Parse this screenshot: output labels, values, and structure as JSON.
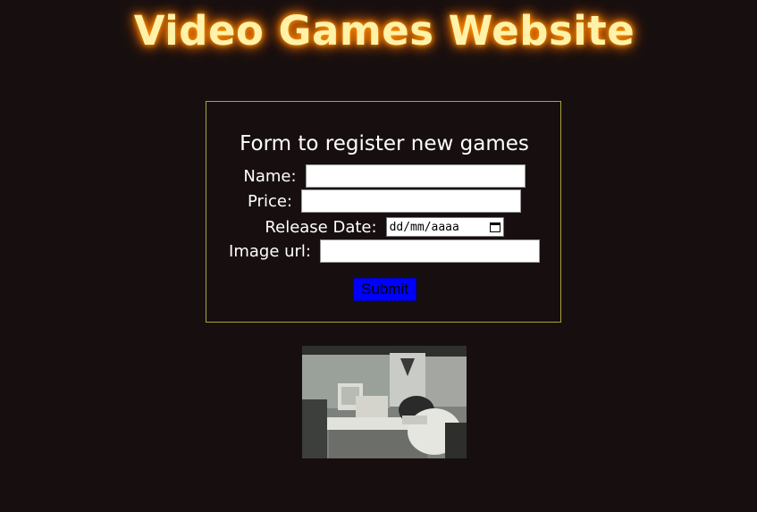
{
  "header": {
    "title": "Video Games Website"
  },
  "form": {
    "heading": "Form to register new games",
    "fields": {
      "name_label": "Name:",
      "name_value": "",
      "price_label": "Price:",
      "price_value": "",
      "release_label": "Release Date:",
      "release_placeholder": "dd/mm/aaaa",
      "image_label": "Image url:",
      "image_value": ""
    },
    "submit_label": "Submit"
  },
  "colors": {
    "background": "#170f0f",
    "title_text": "#fff2a8",
    "title_glow": "#ff7a00",
    "form_border": "#a8a43a",
    "submit_bg": "#0000ff"
  },
  "image": {
    "icon": "office-computer-photo"
  }
}
